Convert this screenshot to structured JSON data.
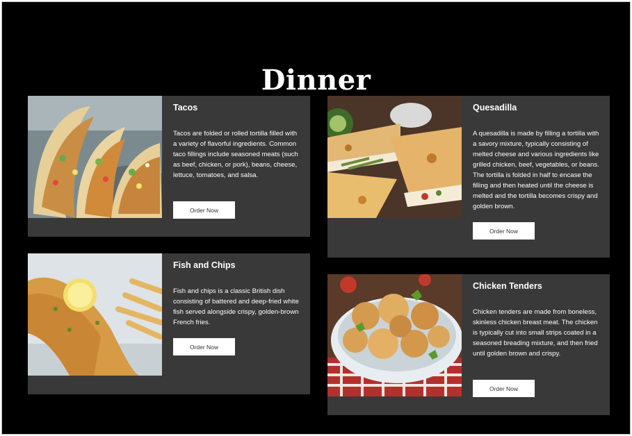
{
  "page": {
    "title": "Dinner"
  },
  "menu": [
    {
      "name": "Tacos",
      "description": "Tacos are folded or rolled tortilla filled with a variety of flavorful ingredients. Common taco fillings include seasoned meats (such as beef, chicken, or pork), beans, cheese, lettuce, tomatoes, and salsa.",
      "button": "Order Now"
    },
    {
      "name": "Quesadilla",
      "description": "A quesadilla is made by filling a tortilla with a savory mixture, typically consisting of melted cheese and various ingredients like grilled chicken, beef, vegetables, or beans. The tortilla is folded in half to encase the filling and then heated until the cheese is melted and the tortilla becomes crispy and golden brown.",
      "button": "Order Now"
    },
    {
      "name": "Fish and Chips",
      "description": "Fish and chips is a classic British dish consisting of battered and deep-fried white fish served alongside crispy, golden-brown French fries.",
      "button": "Order Now"
    },
    {
      "name": "Chicken Tenders",
      "description": "Chicken tenders are made from boneless, skinless chicken breast meat. The chicken is typically cut into small strips coated in a seasoned breading mixture, and then fried until golden brown and crispy.",
      "button": "Order Now"
    }
  ],
  "colors": {
    "background": "#000000",
    "card": "#3a3939",
    "button": "#ffffff",
    "text": "#ffffff"
  }
}
